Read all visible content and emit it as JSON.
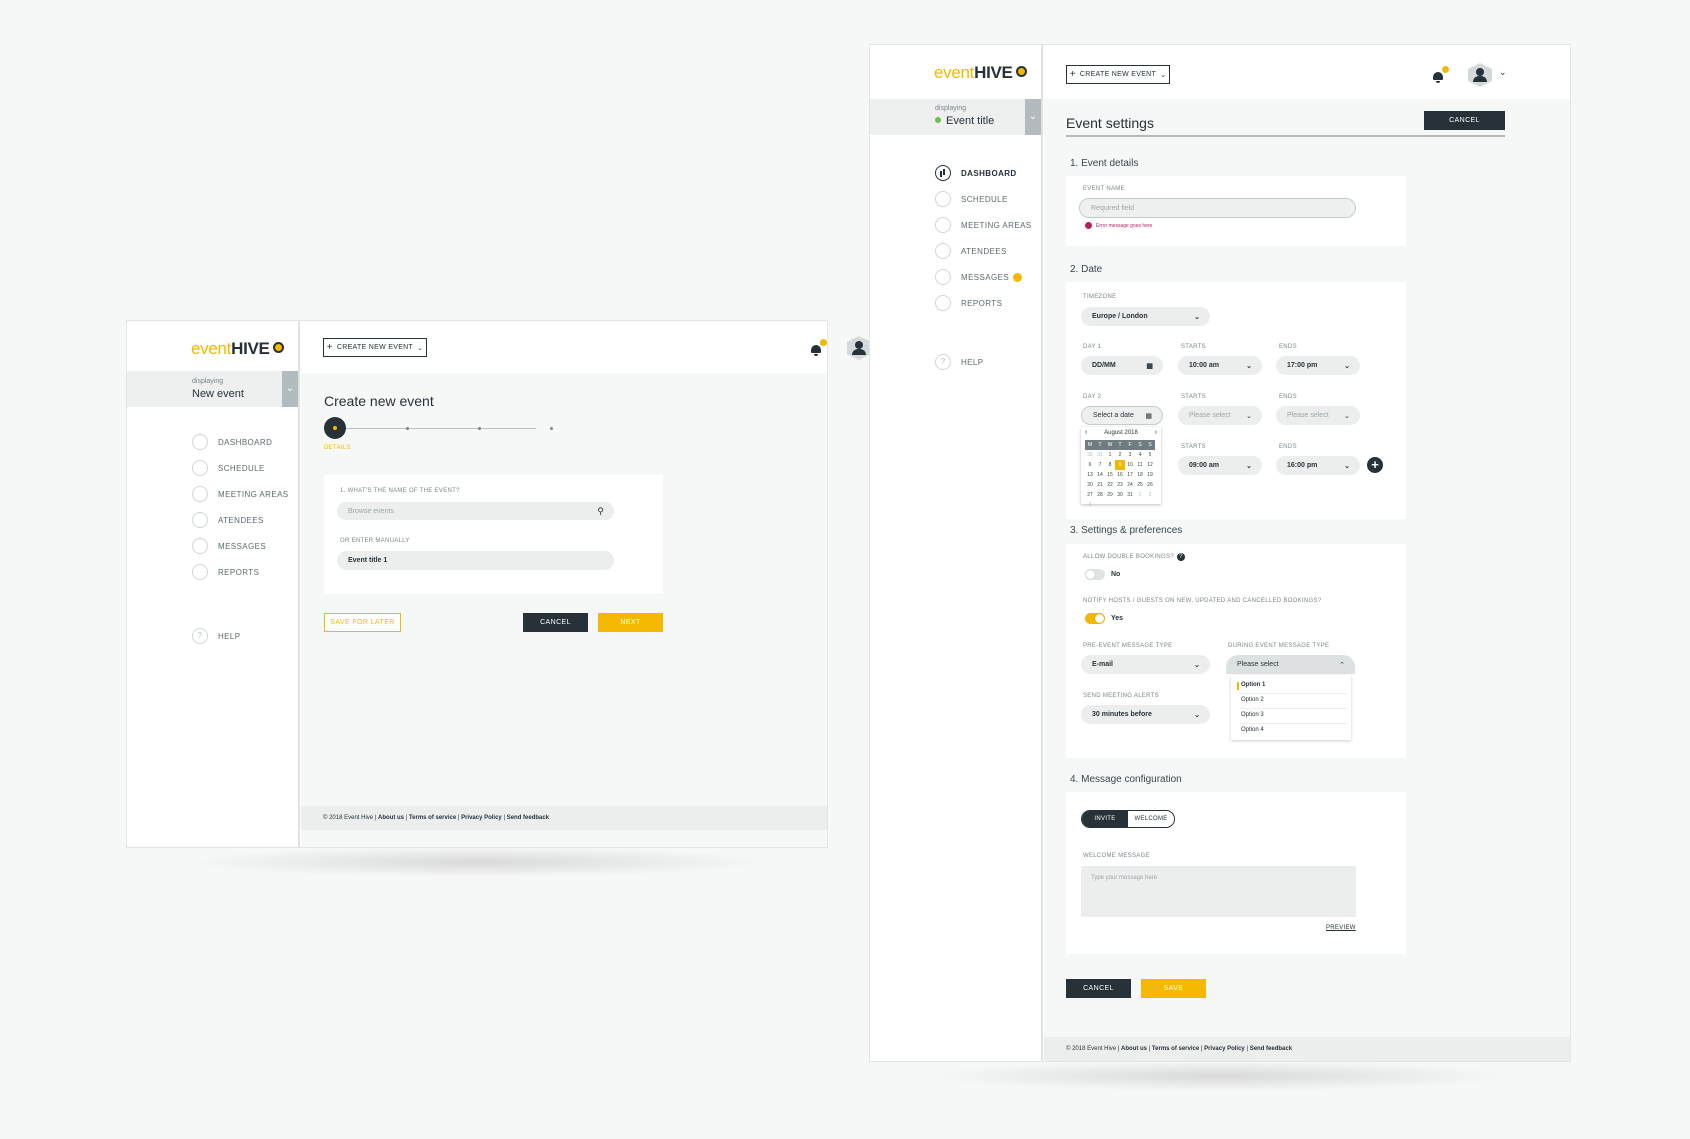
{
  "brand": {
    "logo_event": "event",
    "logo_hive": "HIVE"
  },
  "colors": {
    "accent": "#f5b800",
    "dark": "#263238",
    "bg": "#f6f7f7",
    "error": "#b2225d",
    "success": "#6ac04f"
  },
  "left_screen": {
    "displaying_label": "displaying",
    "displaying_title": "New event",
    "create_label": "CREATE NEW EVENT",
    "nav": [
      {
        "label": "DASHBOARD",
        "icon": "dashboard-icon"
      },
      {
        "label": "SCHEDULE",
        "icon": "schedule-icon"
      },
      {
        "label": "MEETING AREAS",
        "icon": "meeting-areas-icon"
      },
      {
        "label": "ATENDEES",
        "icon": "attendees-icon"
      },
      {
        "label": "MESSAGES",
        "icon": "messages-icon"
      },
      {
        "label": "REPORTS",
        "icon": "reports-icon"
      }
    ],
    "help_label": "HELP",
    "page_title": "Create new event",
    "step_label": "DETAILS",
    "q1_label": "1. WHAT'S THE NAME OF THE EVENT?",
    "search_placeholder": "Browse events",
    "manual_label": "OR ENTER MANUALLY",
    "manual_value": "Event title 1",
    "save_later": "SAVE FOR LATER",
    "cancel": "CANCEL",
    "next": "NEXT",
    "footer": {
      "copy": "© 2018 Event Hive |",
      "about": "About us",
      "terms": "Terms of service",
      "privacy": "Privacy Policy",
      "feedback": "Send feedback",
      "sep": "|"
    }
  },
  "right_screen": {
    "displaying_label": "displaying",
    "displaying_title": "Event title",
    "create_label": "CREATE NEW EVENT",
    "nav": [
      {
        "label": "DASHBOARD",
        "icon": "dashboard-icon",
        "active": true
      },
      {
        "label": "SCHEDULE",
        "icon": "schedule-icon"
      },
      {
        "label": "MEETING AREAS",
        "icon": "meeting-areas-icon"
      },
      {
        "label": "ATENDEES",
        "icon": "attendees-icon"
      },
      {
        "label": "MESSAGES",
        "icon": "messages-icon",
        "badge": true
      },
      {
        "label": "REPORTS",
        "icon": "reports-icon"
      }
    ],
    "help_label": "HELP",
    "page_title": "Event settings",
    "cancel_top": "CANCEL",
    "sec1": "1. Event details",
    "event_name_label": "EVENT NAME",
    "event_name_placeholder": "Required field",
    "error_msg": "Error message goes here",
    "sec2": "2. Date",
    "timezone_label": "TIMEZONE",
    "timezone_value": "Europe / London",
    "day1_label": "DAY 1",
    "day1_value": "DD/MM",
    "starts_label": "STARTS",
    "ends_label": "ENDS",
    "day1_start": "10:00 am",
    "day1_end": "17:00 pm",
    "day2_label": "DAY 2",
    "day2_value": "Select a date",
    "please_select": "Please select",
    "day3_start": "09:00 am",
    "day3_end": "16:00 pm",
    "calendar": {
      "month": "August 2018",
      "weekdays": [
        "M",
        "T",
        "W",
        "T",
        "F",
        "S",
        "S"
      ],
      "days": [
        {
          "d": "30",
          "m": true
        },
        {
          "d": "31",
          "m": true
        },
        {
          "d": "1"
        },
        {
          "d": "2"
        },
        {
          "d": "3"
        },
        {
          "d": "4"
        },
        {
          "d": "5"
        },
        {
          "d": "6"
        },
        {
          "d": "7"
        },
        {
          "d": "8"
        },
        {
          "d": "9",
          "t": true
        },
        {
          "d": "10"
        },
        {
          "d": "11"
        },
        {
          "d": "12"
        },
        {
          "d": "13"
        },
        {
          "d": "14"
        },
        {
          "d": "15"
        },
        {
          "d": "16"
        },
        {
          "d": "17"
        },
        {
          "d": "18"
        },
        {
          "d": "19"
        },
        {
          "d": "20"
        },
        {
          "d": "21"
        },
        {
          "d": "22"
        },
        {
          "d": "23"
        },
        {
          "d": "24"
        },
        {
          "d": "25"
        },
        {
          "d": "26"
        },
        {
          "d": "27"
        },
        {
          "d": "28"
        },
        {
          "d": "29"
        },
        {
          "d": "30"
        },
        {
          "d": "31"
        },
        {
          "d": "1",
          "m": true
        },
        {
          "d": "2",
          "m": true
        },
        {
          "d": "3",
          "m": true
        }
      ]
    },
    "sec3": "3. Settings & preferences",
    "double_booking_label": "ALLOW DOUBLE BOOKINGS?",
    "double_booking_value": "No",
    "notify_label": "NOTIFY HOSTS / GUESTS ON NEW, UPDATED AND CANCELLED BOOKINGS?",
    "notify_value": "Yes",
    "pre_msg_label": "PRE-EVENT MESSAGE TYPE",
    "pre_msg_value": "E-mail",
    "during_msg_label": "DURING EVENT MESSAGE TYPE",
    "during_msg_value": "Please select",
    "options": [
      "Option 1",
      "Option 2",
      "Option 3",
      "Option 4"
    ],
    "alerts_label": "SEND MEETING ALERTS",
    "alerts_value": "30 minutes before",
    "sec4": "4. Message configuration",
    "seg_invite": "INVITE",
    "seg_welcome": "WELCOME",
    "welcome_label": "WELCOME MESSAGE",
    "welcome_placeholder": "Type your message here",
    "preview": "PREVIEW",
    "cancel": "CANCEL",
    "save": "SAVE",
    "footer": {
      "copy": "© 2018 Event Hive |",
      "about": "About us",
      "terms": "Terms of service",
      "privacy": "Privacy Policy",
      "feedback": "Send feedback",
      "sep": "|"
    }
  }
}
